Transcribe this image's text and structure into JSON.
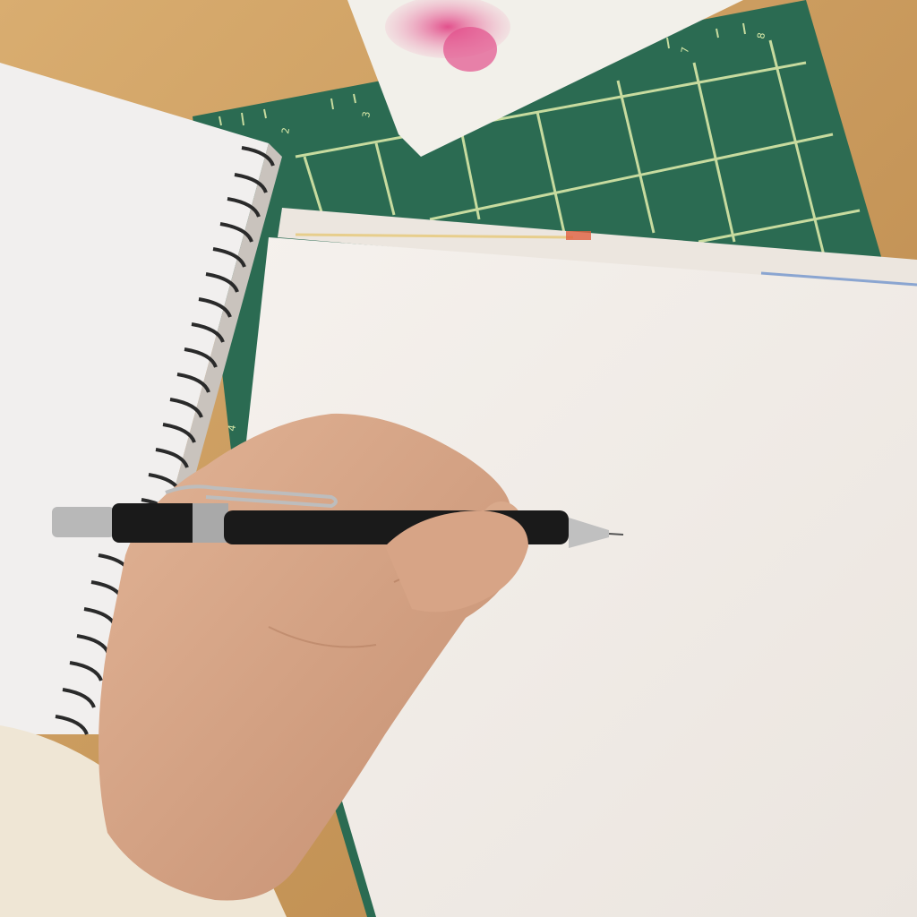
{
  "scene": {
    "description_tags": [
      "desk",
      "cutting-mat",
      "spiral-sketchbook",
      "paper-sheet",
      "watercolor-card",
      "hand",
      "mechanical-pencil",
      "towel-sleeve"
    ],
    "colors": {
      "desk": "#c99a5e",
      "desk_light": "#d9ad70",
      "mat": "#2b6b52",
      "mat_dark": "#1f5641",
      "grid_line": "#d8e8a8",
      "paper": "#f3efeb",
      "paper_shadow": "#e4ddd6",
      "sketchbook": "#f1efee",
      "spiral": "#2a2a2a",
      "card": "#f2f0ea",
      "watercolor": "#e26a98",
      "skin": "#d9a98b",
      "skin_shadow": "#c08a6c",
      "pencil": "#1a1a1a",
      "pencil_metal": "#b8b8b8",
      "towel": "#efe6d5"
    },
    "mat_ruler_numbers": [
      "2",
      "3",
      "4",
      "7",
      "8"
    ]
  }
}
